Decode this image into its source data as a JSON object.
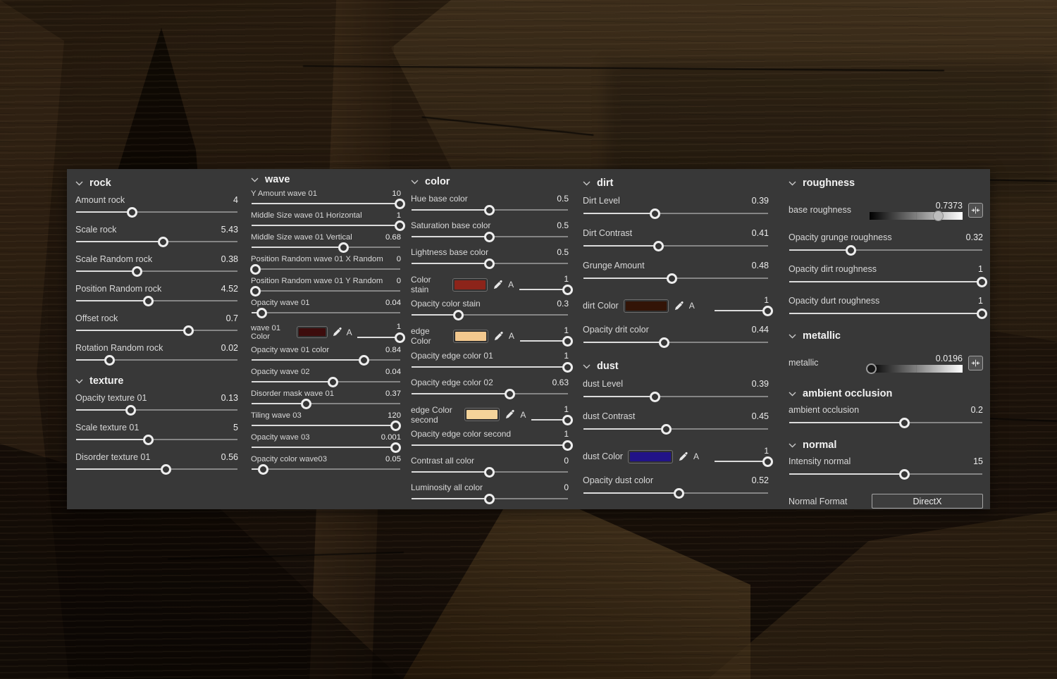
{
  "colors": {
    "panel_bg": "#383838",
    "label_text": "#d8d8d8",
    "value_text": "#ececec",
    "slider_fill": "#dcdcdc",
    "slider_track": "#858585",
    "wave01_color": "#3d0c0c",
    "color_stain": "#8c241a",
    "edge_color": "#f2c88e",
    "edge_color_second": "#f5d49a",
    "dirt_color": "#331407",
    "dust_color": "#221388"
  },
  "panel": {
    "columns": [
      {
        "sections": [
          {
            "title": "rock",
            "params": [
              {
                "label": "Amount rock",
                "value": "4",
                "pos": 35
              },
              {
                "label": "Scale rock",
                "value": "5.43",
                "pos": 54
              },
              {
                "label": "Scale Random rock",
                "value": "0.38",
                "pos": 38
              },
              {
                "label": "Position Random rock",
                "value": "4.52",
                "pos": 45
              },
              {
                "label": "Offset rock",
                "value": "0.7",
                "pos": 70
              },
              {
                "label": "Rotation Random rock",
                "value": "0.02",
                "pos": 21
              }
            ]
          },
          {
            "title": "texture",
            "params": [
              {
                "label": "Opacity texture 01",
                "value": "0.13",
                "pos": 34
              },
              {
                "label": "Scale texture 01",
                "value": "5",
                "pos": 45
              },
              {
                "label": "Disorder texture 01",
                "value": "0.56",
                "pos": 56
              }
            ]
          }
        ]
      },
      {
        "sections": [
          {
            "title": "wave",
            "params": [
              {
                "label": "Y Amount wave 01",
                "value": "10",
                "pos": 100
              },
              {
                "label": "Middle Size wave 01 Horizontal",
                "value": "1",
                "pos": 100
              },
              {
                "label": "Middle Size wave 01 Vertical",
                "value": "0.68",
                "pos": 62
              },
              {
                "label": "Position Random wave 01 X Random",
                "value": "0",
                "pos": 3
              },
              {
                "label": "Position Random wave 01 Y Random",
                "value": "0",
                "pos": 3
              },
              {
                "label": "Opacity wave 01",
                "value": "0.04",
                "pos": 7
              },
              {
                "label": "wave 01 Color",
                "value": "1",
                "pos": 100,
                "alpha_label": "A",
                "swatch": "#3d0c0c",
                "swatch_style": "background:#3d0c0c"
              },
              {
                "label": "Opacity wave 01 color",
                "value": "0.84",
                "pos": 76
              },
              {
                "label": "Opacity wave 02",
                "value": "0.04",
                "pos": 55
              },
              {
                "label": "Disorder mask wave 01",
                "value": "0.37",
                "pos": 37
              },
              {
                "label": "Tiling wave 03",
                "value": "120",
                "pos": 97
              },
              {
                "label": "Opacity wave 03",
                "value": "0.001",
                "pos": 97
              },
              {
                "label": "Opacity color wave03",
                "value": "0.05",
                "pos": 8
              }
            ]
          }
        ]
      },
      {
        "sections": [
          {
            "title": "color",
            "params": [
              {
                "label": "Hue base color",
                "value": "0.5",
                "pos": 50
              },
              {
                "label": "Saturation base color",
                "value": "0.5",
                "pos": 50
              },
              {
                "label": "Lightness base color",
                "value": "0.5",
                "pos": 50
              },
              {
                "label": "Color stain",
                "value": "1",
                "pos": 100,
                "alpha_label": "A",
                "swatch": "#8c241a",
                "swatch_style": "background:#8c241a"
              },
              {
                "label": "Opacity color stain",
                "value": "0.3",
                "pos": 30
              },
              {
                "label": "edge Color",
                "value": "1",
                "pos": 100,
                "alpha_label": "A",
                "swatch": "#f2c88e",
                "swatch_style": "background:#f2c88e"
              },
              {
                "label": "Opacity edge color 01",
                "value": "1",
                "pos": 100
              },
              {
                "label": "Opacity edge color 02",
                "value": "0.63",
                "pos": 63
              },
              {
                "label": "edge Color second",
                "value": "1",
                "pos": 100,
                "alpha_label": "A",
                "swatch": "#f5d49a",
                "swatch_style": "background:#f5d49a"
              },
              {
                "label": "Opacity edge color second",
                "value": "1",
                "pos": 100
              },
              {
                "label": "Contrast all color",
                "value": "0",
                "pos": 50
              },
              {
                "label": "Luminosity all color",
                "value": "0",
                "pos": 50
              }
            ]
          }
        ]
      },
      {
        "sections": [
          {
            "title": "dirt",
            "params": [
              {
                "label": "Dirt Level",
                "value": "0.39",
                "pos": 39
              },
              {
                "label": "Dirt Contrast",
                "value": "0.41",
                "pos": 41
              },
              {
                "label": "Grunge Amount",
                "value": "0.48",
                "pos": 48
              },
              {
                "label": "dirt Color",
                "value": "1",
                "pos": 100,
                "alpha_label": "A",
                "swatch": "#331407",
                "swatch_style": "background:#331407"
              },
              {
                "label": "Opacity drit color",
                "value": "0.44",
                "pos": 44
              }
            ]
          },
          {
            "title": "dust",
            "params": [
              {
                "label": "dust Level",
                "value": "0.39",
                "pos": 39
              },
              {
                "label": "dust Contrast",
                "value": "0.45",
                "pos": 45
              },
              {
                "label": "dust Color",
                "value": "1",
                "pos": 100,
                "alpha_label": "A",
                "swatch": "#221388",
                "swatch_style": "background:#221388"
              },
              {
                "label": "Opacity dust color",
                "value": "0.52",
                "pos": 52
              }
            ]
          }
        ]
      },
      {
        "sections": [
          {
            "title": "roughness",
            "params": [
              {
                "label": "base roughness",
                "value": "0.7373",
                "pos": 74
              },
              {
                "label": "Opacity grunge roughness",
                "value": "0.32",
                "pos": 32
              },
              {
                "label": "Opacity dirt roughness",
                "value": "1",
                "pos": 100
              },
              {
                "label": "Opacity durt roughness",
                "value": "1",
                "pos": 100
              }
            ]
          },
          {
            "title": "metallic",
            "params": [
              {
                "label": "metallic",
                "value": "0.0196",
                "pos": 2
              }
            ]
          },
          {
            "title": "ambient occlusion",
            "params": [
              {
                "label": "ambient occlusion",
                "value": "0.2",
                "pos": 60
              }
            ]
          },
          {
            "title": "normal",
            "params": [
              {
                "label": "Intensity normal",
                "value": "15",
                "pos": 60
              },
              {
                "label": "Normal Format",
                "value": "DirectX"
              }
            ]
          }
        ]
      }
    ]
  }
}
